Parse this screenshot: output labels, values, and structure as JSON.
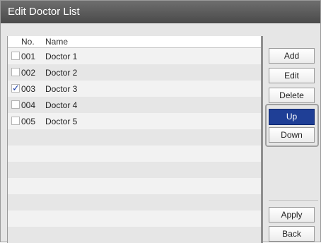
{
  "title": "Edit Doctor List",
  "list": {
    "header_no": "No.",
    "header_name": "Name",
    "rows": [
      {
        "no": "001",
        "name": "Doctor 1",
        "checked": false
      },
      {
        "no": "002",
        "name": "Doctor 2",
        "checked": false
      },
      {
        "no": "003",
        "name": "Doctor 3",
        "checked": true
      },
      {
        "no": "004",
        "name": "Doctor 4",
        "checked": false
      },
      {
        "no": "005",
        "name": "Doctor 5",
        "checked": false
      }
    ],
    "empty_rows": 7
  },
  "buttons": {
    "add": "Add",
    "edit": "Edit",
    "delete": "Delete",
    "up": "Up",
    "down": "Down",
    "apply": "Apply",
    "back": "Back"
  },
  "colors": {
    "selected_button": "#1f3f96",
    "checkmark": "#1b3ea8"
  }
}
